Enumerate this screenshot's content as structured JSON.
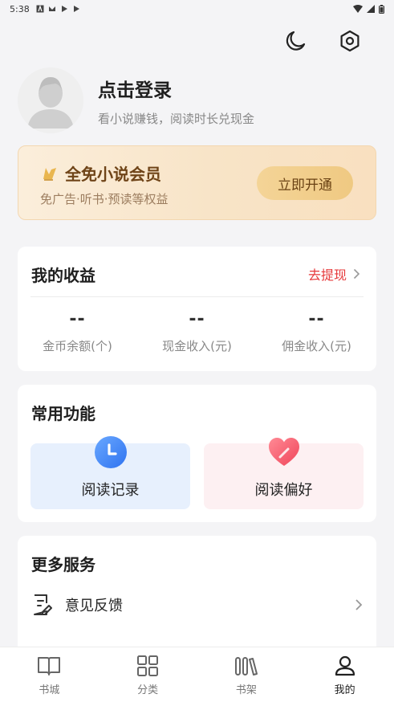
{
  "status_bar": {
    "time": "5:38",
    "icons": [
      "a-icon",
      "mail-icon",
      "play-icon",
      "play-icon"
    ]
  },
  "header": {
    "icons": [
      "moon-icon",
      "settings-hex-icon"
    ]
  },
  "profile": {
    "title": "点击登录",
    "subtitle": "看小说赚钱，阅读时长兑现金"
  },
  "vip": {
    "title": "全免小说会员",
    "subtitle": "免广告·听书·预读等权益",
    "button": "立即开通",
    "icon": "crown-icon"
  },
  "earnings": {
    "title": "我的收益",
    "withdraw": "去提现",
    "stats": [
      {
        "value": "--",
        "label": "金币余额(个)"
      },
      {
        "value": "--",
        "label": "现金收入(元)"
      },
      {
        "value": "--",
        "label": "佣金收入(元)"
      }
    ]
  },
  "functions": {
    "title": "常用功能",
    "items": [
      {
        "label": "阅读记录",
        "icon": "clock-icon"
      },
      {
        "label": "阅读偏好",
        "icon": "heart-icon"
      }
    ]
  },
  "services": {
    "title": "更多服务",
    "items": [
      {
        "label": "意见反馈",
        "icon": "feedback-icon"
      }
    ]
  },
  "tabs": [
    {
      "label": "书城",
      "icon": "book-open-icon",
      "active": false
    },
    {
      "label": "分类",
      "icon": "grid-icon",
      "active": false
    },
    {
      "label": "书架",
      "icon": "bookshelf-icon",
      "active": false
    },
    {
      "label": "我的",
      "icon": "user-icon",
      "active": true
    }
  ],
  "colors": {
    "accent_red": "#e6383a",
    "vip_brown": "#6f4418",
    "vip_button": "#f0cd8b",
    "read_tile": "#e7f0fd",
    "fav_tile": "#fdf0f2"
  }
}
